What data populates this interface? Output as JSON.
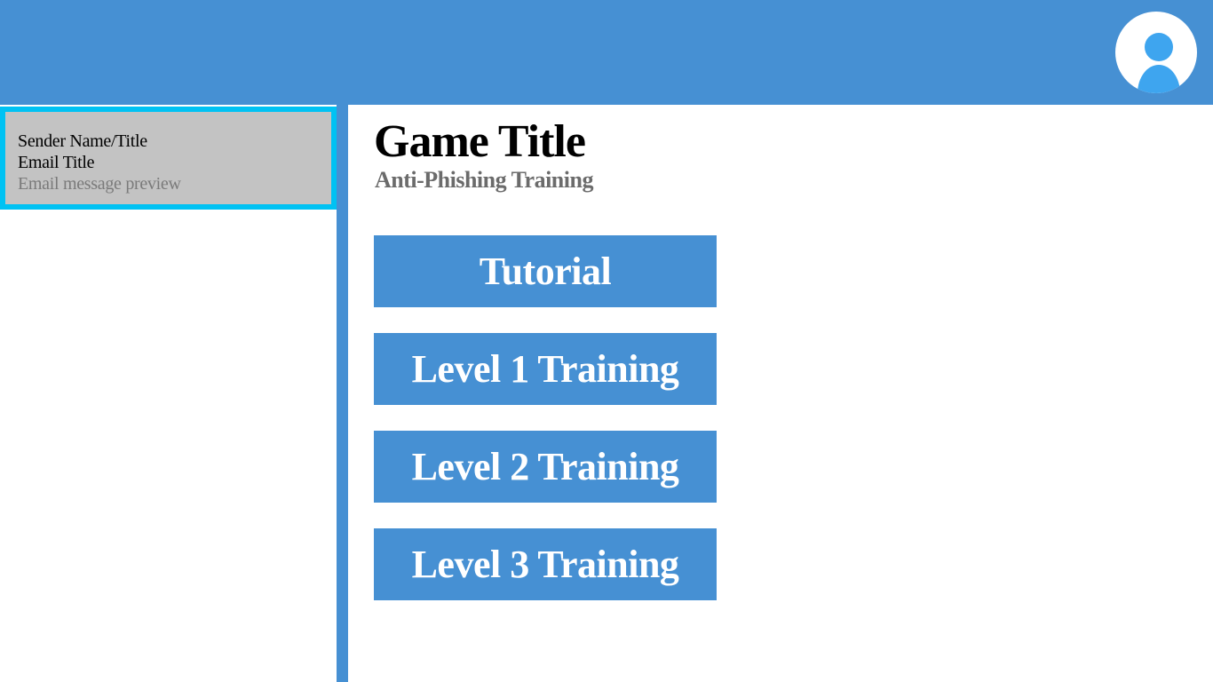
{
  "header": {
    "avatar_icon": "user-profile-icon",
    "background_color": "#4690d3"
  },
  "sidebar": {
    "emails": [
      {
        "sender": "Sender Name/Title",
        "title": "Email Title",
        "preview": "Email message preview",
        "selected": true
      }
    ],
    "selected_border_color": "#00c2f3",
    "item_background_color": "#c3c3c3"
  },
  "main": {
    "title": "Game Title",
    "subtitle": "Anti-Phishing Training",
    "menu": [
      {
        "label": "Tutorial"
      },
      {
        "label": "Level 1 Training"
      },
      {
        "label": "Level 2 Training"
      },
      {
        "label": "Level 3 Training"
      }
    ],
    "button_color": "#4690d3"
  }
}
